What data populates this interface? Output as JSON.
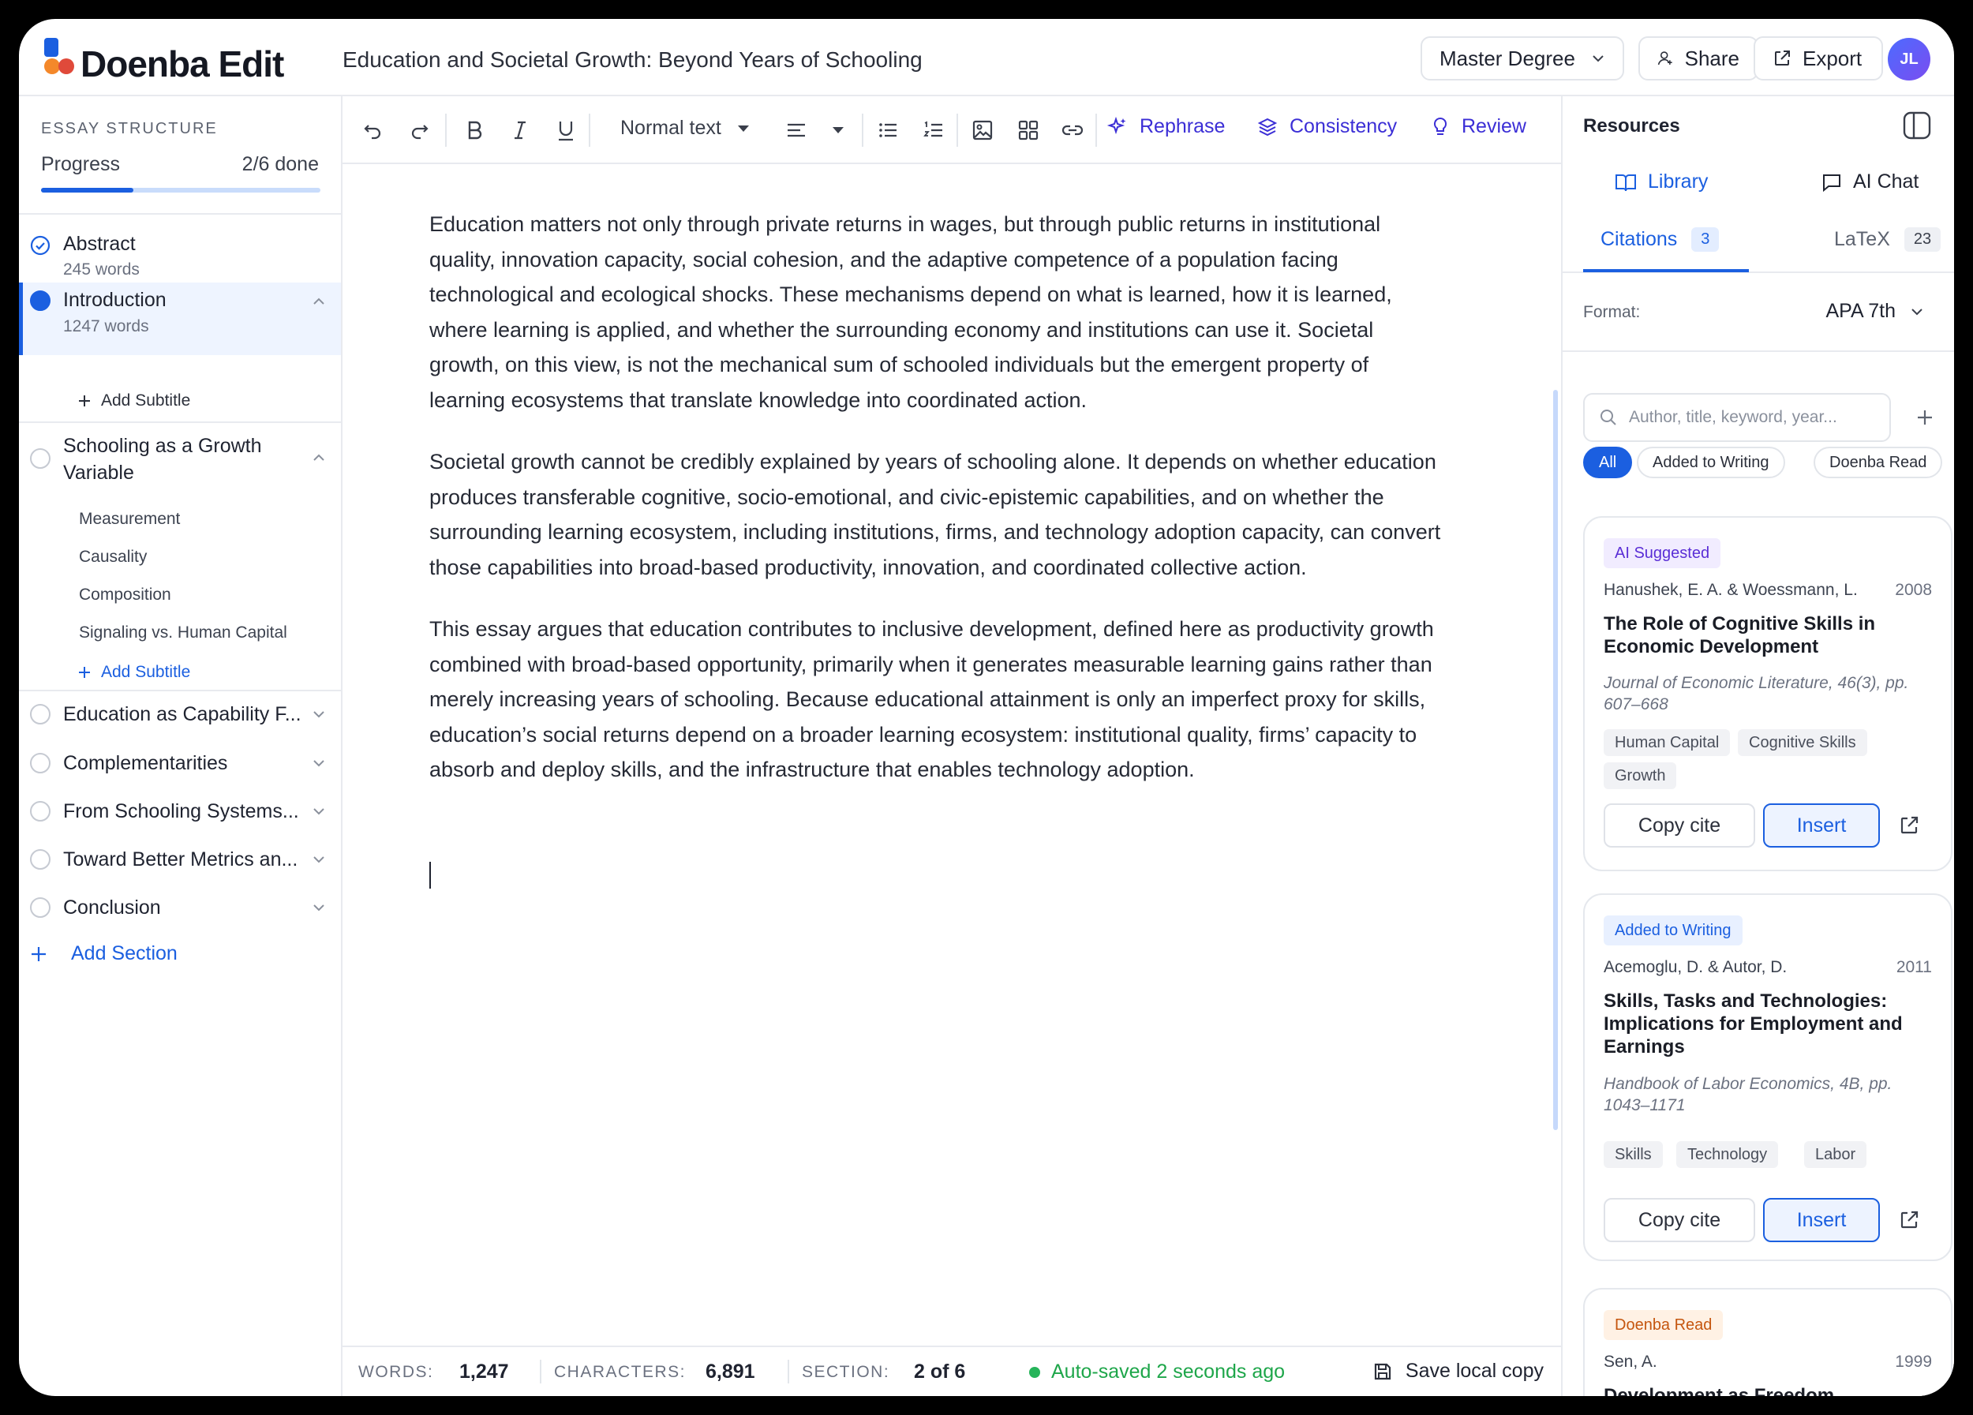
{
  "app": {
    "name": "Doenba Edit",
    "doc_title": "Education and Societal Growth: Beyond Years of Schooling",
    "degree": "Master Degree",
    "share_label": "Share",
    "export_label": "Export",
    "avatar_initials": "JL"
  },
  "sidebar": {
    "structure_label": "ESSAY STRUCTURE",
    "progress_label": "Progress",
    "progress_done": "2/6 done",
    "progress_fraction": 0.33,
    "sections": [
      {
        "title": "Abstract",
        "words": "245 words",
        "state": "done"
      },
      {
        "title": "Introduction",
        "words": "1247 words",
        "state": "active",
        "add_subtitle": "Add Subtitle"
      },
      {
        "title": "Schooling as a Growth Variable",
        "subsections": [
          "Measurement",
          "Causality",
          "Composition",
          "Signaling vs. Human Capital"
        ],
        "add_subtitle": "Add Subtitle"
      },
      {
        "title": "Education as Capability F..."
      },
      {
        "title": "Complementarities"
      },
      {
        "title": "From Schooling Systems..."
      },
      {
        "title": "Toward Better Metrics an..."
      },
      {
        "title": "Conclusion"
      }
    ],
    "add_section": "Add Section"
  },
  "toolbar": {
    "text_style": "Normal text",
    "rephrase": "Rephrase",
    "consistency": "Consistency",
    "review": "Review"
  },
  "editor": {
    "paragraphs": [
      "Education matters not only through private returns in wages, but through public returns in institutional quality, innovation capacity, social cohesion, and the adaptive competence of a population facing technological and ecological shocks. These mechanisms depend on what is learned, how it is learned, where learning is applied, and whether the surrounding economy and institutions can use it. Societal growth, on this view, is not the mechanical sum of schooled individuals but the emergent property of learning ecosystems that translate knowledge into coordinated action.",
      "Societal growth cannot be credibly explained by years of schooling alone. It depends on whether education produces transferable cognitive, socio-emotional, and civic-epistemic capabilities, and on whether the surrounding learning ecosystem, including institutions, firms, and technology adoption capacity, can convert those capabilities into broad-based productivity, innovation, and coordinated collective action.",
      "This essay argues that education contributes to inclusive development, defined here as productivity growth combined with broad-based opportunity, primarily when it generates measurable learning gains rather than merely increasing years of schooling. Because educational attainment is only an imperfect proxy for skills, education’s social returns depend on a broader learning ecosystem: institutional quality, firms’ capacity to absorb and deploy skills, and the infrastructure that enables technology adoption."
    ]
  },
  "status": {
    "words_label": "WORDS:",
    "words": "1,247",
    "chars_label": "CHARACTERS:",
    "chars": "6,891",
    "section_label": "SECTION:",
    "section": "2 of 6",
    "autosave": "Auto-saved 2 seconds ago",
    "save_local": "Save local copy"
  },
  "resources": {
    "title": "Resources",
    "tab_library": "Library",
    "tab_ai_chat": "AI Chat",
    "citations_label": "Citations",
    "citations_count": "3",
    "latex_label": "LaTeX",
    "latex_count": "23",
    "format_label": "Format:",
    "format_value": "APA 7th",
    "search_placeholder": "Author, title, keyword, year...",
    "filters": [
      "All",
      "Added to Writing",
      "Doenba Read"
    ],
    "copy_label": "Copy cite",
    "insert_label": "Insert",
    "cards": [
      {
        "badge": "AI Suggested",
        "authors": "Hanushek, E. A. & Woessmann, L.",
        "year": "2008",
        "title": "The Role of Cognitive Skills in Economic Development",
        "journal": "Journal of Economic Literature, 46(3), pp. 607–668",
        "tags": [
          "Human Capital",
          "Cognitive Skills",
          "Growth"
        ]
      },
      {
        "badge": "Added to Writing",
        "authors": "Acemoglu, D. & Autor, D.",
        "year": "2011",
        "title": "Skills, Tasks and Technologies: Implications for Employment and Earnings",
        "journal": "Handbook of Labor Economics, 4B, pp. 1043–1171",
        "tags": [
          "Skills",
          "Technology",
          "Labor"
        ]
      },
      {
        "badge": "Doenba Read",
        "authors": "Sen, A.",
        "year": "1999",
        "title": "Development as Freedom"
      }
    ]
  },
  "colors": {
    "accent": "#1b5fe0",
    "ai_purple": "#3b2ed6",
    "success": "#1ea64a"
  }
}
